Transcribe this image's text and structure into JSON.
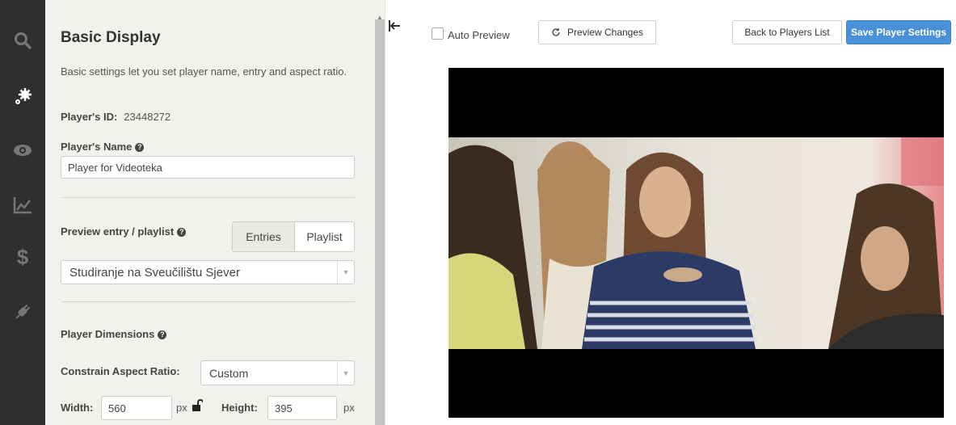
{
  "rail": {
    "icons": [
      "search-icon",
      "gear-icon",
      "eye-icon",
      "chart-icon",
      "dollar-icon",
      "plugin-icon"
    ],
    "active": "gear-icon"
  },
  "panel": {
    "title": "Basic Display",
    "description": "Basic settings let you set player name, entry and aspect ratio.",
    "player_id_label": "Player's ID:",
    "player_id_value": "23448272",
    "player_name_label": "Player's Name",
    "player_name_value": "Player for Videoteka",
    "preview_label": "Preview entry / playlist",
    "tabs": {
      "entries": "Entries",
      "playlist": "Playlist",
      "selected": "Entries"
    },
    "entry_select": "Studiranje na Sveučilištu Sjever",
    "dimensions_label": "Player Dimensions",
    "aspect_label": "Constrain Aspect Ratio:",
    "aspect_value": "Custom",
    "width_label": "Width:",
    "width_value": "560",
    "height_label": "Height:",
    "height_value": "395",
    "unit": "px"
  },
  "toolbar": {
    "auto_preview": "Auto Preview",
    "preview_changes": "Preview Changes",
    "back": "Back to Players List",
    "save": "Save Player Settings"
  },
  "colors": {
    "primary": "#4a90d9",
    "rail_bg": "#2f2f2f",
    "panel_bg": "#f2f1ee"
  }
}
